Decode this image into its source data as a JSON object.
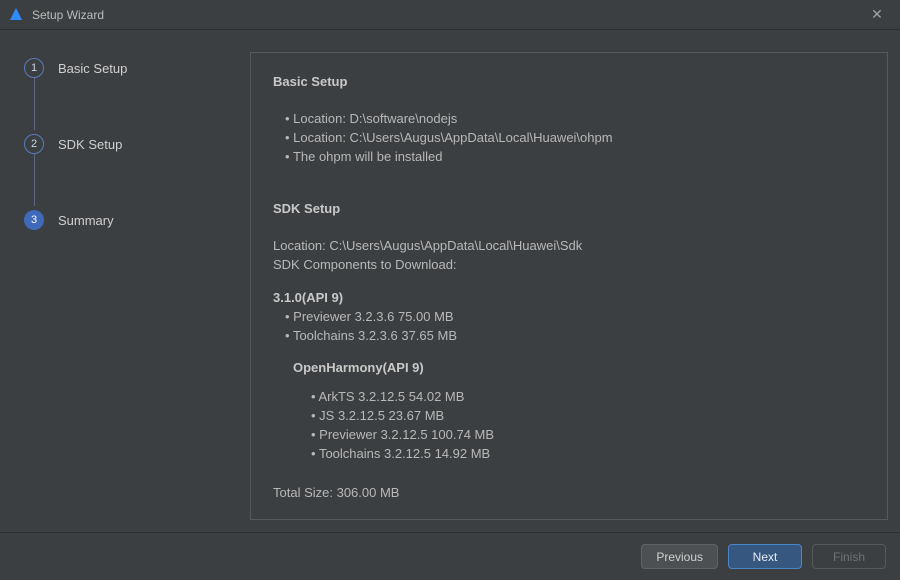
{
  "window": {
    "title": "Setup Wizard"
  },
  "steps": [
    {
      "num": "1",
      "label": "Basic Setup"
    },
    {
      "num": "2",
      "label": "SDK Setup"
    },
    {
      "num": "3",
      "label": "Summary"
    }
  ],
  "summary": {
    "basic": {
      "heading": "Basic Setup",
      "items": [
        "Location: D:\\software\\nodejs",
        "Location: C:\\Users\\Augus\\AppData\\Local\\Huawei\\ohpm",
        "The ohpm will be installed"
      ]
    },
    "sdk": {
      "heading": "SDK Setup",
      "location": "Location: C:\\Users\\Augus\\AppData\\Local\\Huawei\\Sdk",
      "components_label": "SDK Components to Download:",
      "version_heading": "3.1.0(API 9)",
      "top_items": [
        "Previewer  3.2.3.6  75.00 MB",
        "Toolchains  3.2.3.6  37.65 MB"
      ],
      "subgroup_heading": "OpenHarmony(API 9)",
      "sub_items": [
        "ArkTS  3.2.12.5  54.02 MB",
        "JS  3.2.12.5  23.67 MB",
        "Previewer  3.2.12.5  100.74 MB",
        "Toolchains  3.2.12.5  14.92 MB"
      ],
      "total": "Total Size: 306.00 MB"
    }
  },
  "footer": {
    "previous": "Previous",
    "next": "Next",
    "finish": "Finish"
  }
}
